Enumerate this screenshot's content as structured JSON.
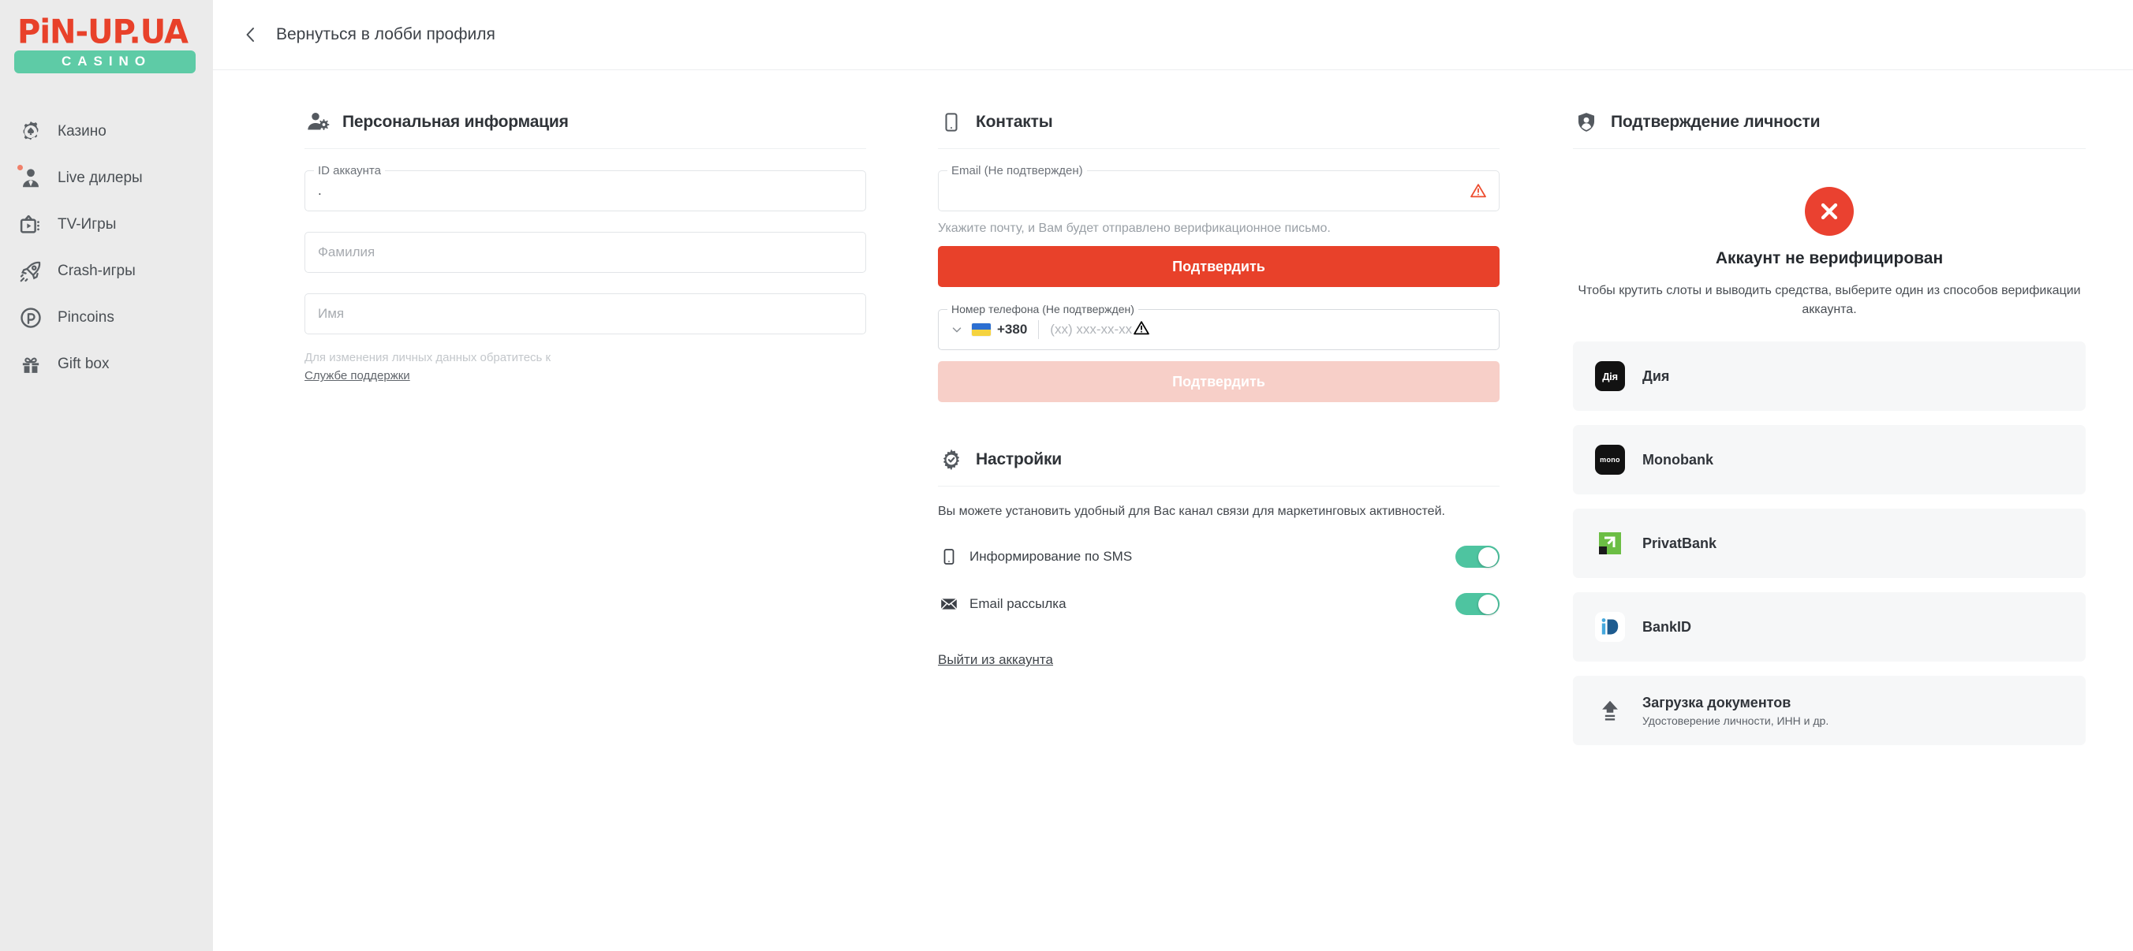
{
  "brand": {
    "logo_top": "PiN-UP.UA",
    "logo_bottom": "CASINO",
    "logo_red": "#e8412a",
    "logo_green": "#5ecba6"
  },
  "sidebar": {
    "items": [
      {
        "label": "Казино",
        "icon": "casino-chip-icon",
        "badge": false
      },
      {
        "label": "Live дилеры",
        "icon": "live-dealer-icon",
        "badge": true
      },
      {
        "label": "TV-Игры",
        "icon": "tv-icon",
        "badge": false
      },
      {
        "label": "Crash-игры",
        "icon": "rocket-icon",
        "badge": false
      },
      {
        "label": "Pincoins",
        "icon": "pincoin-icon",
        "badge": false
      },
      {
        "label": "Gift box",
        "icon": "gift-icon",
        "badge": false
      }
    ]
  },
  "topbar": {
    "back_label": "Вернуться в лобби профиля",
    "back_icon": "chevron-left-icon"
  },
  "personal": {
    "title": "Персональная информация",
    "icon": "user-settings-icon",
    "account_id": {
      "legend": "ID аккаунта",
      "value": "."
    },
    "lastname": {
      "placeholder": "Фамилия",
      "value": ""
    },
    "firstname": {
      "placeholder": "Имя",
      "value": ""
    },
    "hint": "Для изменения личных данных обратитесь к",
    "support_link": "Службе поддержки"
  },
  "contacts": {
    "title": "Контакты",
    "icon": "mobile-phone-icon",
    "email": {
      "legend": "Email (Не подтвержден)",
      "value": "",
      "warning_icon": "warning-triangle-icon"
    },
    "email_helper": "Укажите почту, и Вам будет отправлено верификационное письмо.",
    "email_confirm_label": "Подтвердить",
    "phone": {
      "legend": "Номер телефона (Не подтвержден)",
      "dial_code": "+380",
      "placeholder": "(xx) xxx-xx-xx",
      "value": "",
      "flag": "ua-flag-icon",
      "chevron": "chevron-down-icon",
      "warning_icon": "warning-triangle-icon"
    },
    "phone_confirm_label": "Подтвердить",
    "primary_color": "#e8412a",
    "disabled_color": "#f7cfc8"
  },
  "settings": {
    "title": "Настройки",
    "icon": "gear-check-icon",
    "description": "Вы можете установить удобный для Вас канал связи для маркетинговых активностей.",
    "toggles": [
      {
        "label": "Информирование по SMS",
        "icon": "mobile-phone-icon",
        "on": true
      },
      {
        "label": "Email рассылка",
        "icon": "envelope-icon",
        "on": true
      }
    ],
    "toggle_color": "#4ec4a0",
    "logout_label": "Выйти из аккаунта"
  },
  "verification": {
    "title": "Подтверждение личности",
    "icon": "shield-user-icon",
    "status_icon": "cross-circle-icon",
    "status_color": "#ea4130",
    "status_title": "Аккаунт не верифицирован",
    "status_description": "Чтобы крутить слоты и выводить средства, выберите один из способов верификации аккаунта.",
    "methods": [
      {
        "label": "Дия",
        "logo": "diia-logo-icon",
        "logo_text": "Дія",
        "sub": ""
      },
      {
        "label": "Monobank",
        "logo": "monobank-logo-icon",
        "logo_text": "mono",
        "sub": ""
      },
      {
        "label": "PrivatBank",
        "logo": "privatbank-logo-icon",
        "logo_text": "",
        "sub": ""
      },
      {
        "label": "BankID",
        "logo": "bankid-logo-icon",
        "logo_text": "iD",
        "sub": ""
      },
      {
        "label": "Загрузка документов",
        "logo": "upload-icon",
        "logo_text": "",
        "sub": "Удостоверение личности, ИНН и др."
      }
    ]
  }
}
